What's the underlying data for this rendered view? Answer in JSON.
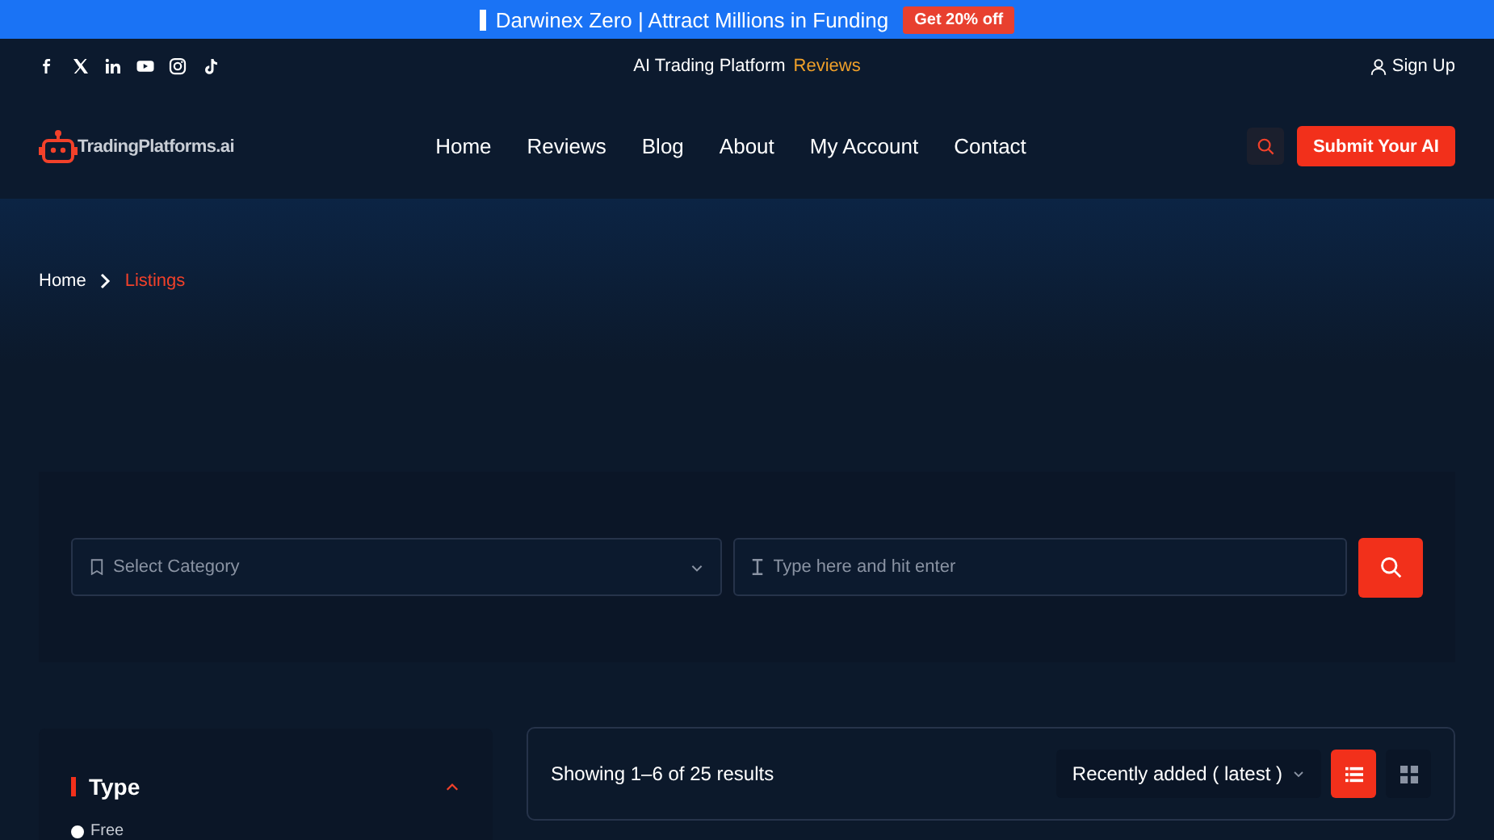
{
  "promo_banner": {
    "text": "Darwinex Zero | Attract Millions in Funding",
    "badge": "Get 20% off"
  },
  "top_bar": {
    "social": [
      {
        "kind": "facebook"
      },
      {
        "kind": "x"
      },
      {
        "kind": "linkedin"
      },
      {
        "kind": "youtube"
      },
      {
        "kind": "instagram"
      },
      {
        "kind": "tiktok"
      }
    ],
    "tagline": "AI Trading Platform",
    "tagline_link": "Reviews",
    "sign_up": "Sign Up"
  },
  "header": {
    "logo": "TradingPlatforms.ai",
    "nav": [
      {
        "label": "Home"
      },
      {
        "label": "Reviews"
      },
      {
        "label": "Blog"
      },
      {
        "label": "About"
      },
      {
        "label": "My Account"
      },
      {
        "label": "Contact"
      }
    ],
    "submit_button": "Submit Your AI"
  },
  "breadcrumb": [
    "Home",
    "Listings"
  ],
  "search": {
    "category_placeholder": "Select Category",
    "placeholder": "Type here and hit enter"
  },
  "filters": {
    "title": "Type",
    "expanded": true,
    "options": [
      {
        "label": "Free",
        "selected": true
      }
    ]
  },
  "results": {
    "summary": "Showing 1–6 of 25 results",
    "sort": "Recently added ( latest )",
    "views": [
      {
        "kind": "list",
        "selected": true
      },
      {
        "kind": "grid",
        "selected": false
      }
    ]
  }
}
